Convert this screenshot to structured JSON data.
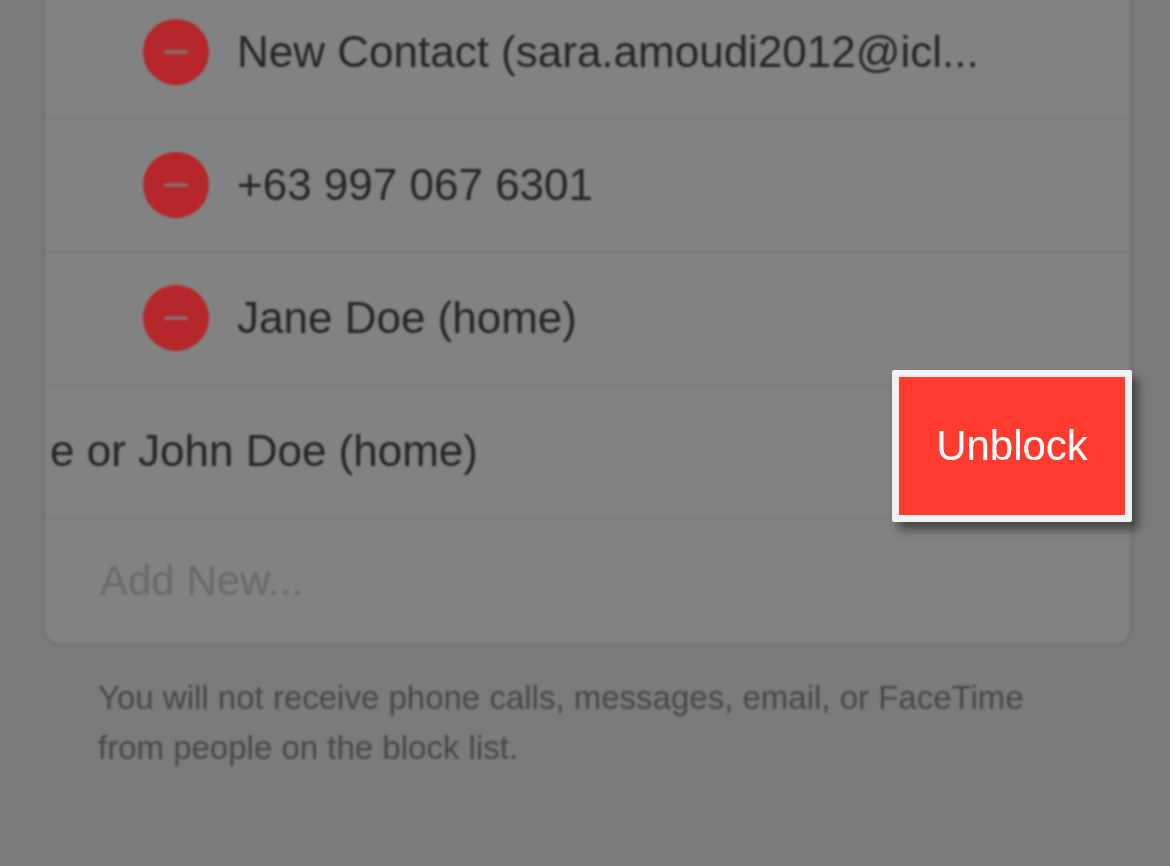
{
  "blocked_list": [
    {
      "label": "New Contact (sara.amoudi2012@icl...",
      "swiped": false
    },
    {
      "label": "+63 997 067 6301",
      "swiped": false
    },
    {
      "label": "Jane Doe (home)",
      "swiped": false
    },
    {
      "label": "e or John Doe (home)",
      "swiped": true,
      "action": "Unblock"
    }
  ],
  "add_new": {
    "placeholder": "Add New..."
  },
  "footer": "You will not receive phone calls, messages, email, or FaceTime from people on the block list."
}
